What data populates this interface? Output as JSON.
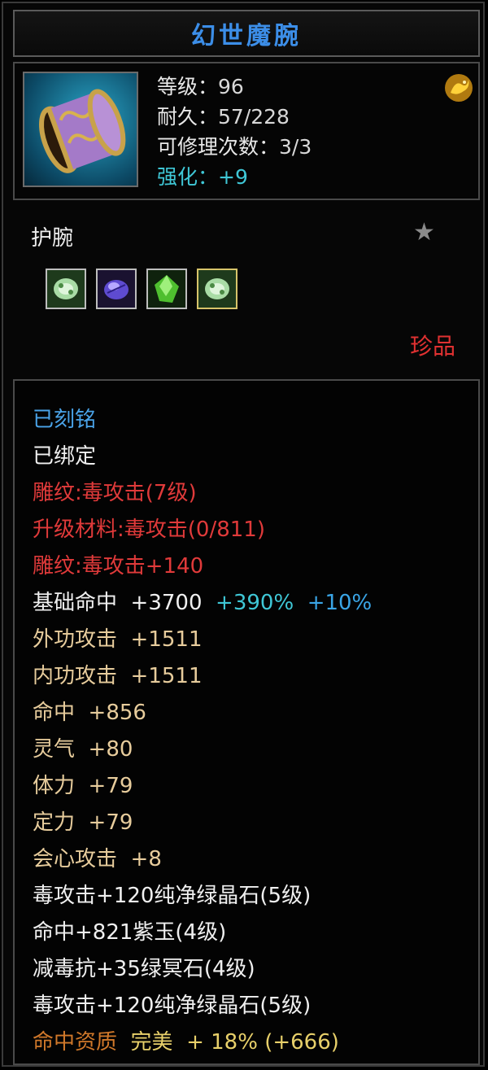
{
  "title": "幻世魔腕",
  "item": {
    "icon": "bracer-item-icon",
    "stats": [
      {
        "label": "等级：",
        "value": "96"
      },
      {
        "label": "耐久：",
        "value": "57/228"
      },
      {
        "label": "可修理次数：",
        "value": "3/3"
      },
      {
        "label": "强化：",
        "value": "+9"
      }
    ],
    "badge_icon": "gold-dragon-icon"
  },
  "type_label": "护腕",
  "star_icon": "star-icon",
  "gem_slots": [
    "green-gem-icon",
    "purple-gem-icon",
    "green-crystal-icon",
    "green-gem-icon"
  ],
  "rarity": "珍品",
  "lines": {
    "engraved": "已刻铭",
    "bound": "已绑定",
    "carving": "雕纹:毒攻击(7级)",
    "upgrade_material": "升级材料:毒攻击(0/811)",
    "carving_bonus": "雕纹:毒攻击+140",
    "base_hit_label": "基础命中",
    "base_hit_value": "+3700",
    "base_hit_pct1": "+390%",
    "base_hit_pct2": "+10%",
    "attrs": [
      {
        "label": "外功攻击",
        "value": "+1511"
      },
      {
        "label": "内功攻击",
        "value": "+1511"
      },
      {
        "label": "命中",
        "value": "+856"
      },
      {
        "label": "灵气",
        "value": "+80"
      },
      {
        "label": "体力",
        "value": "+79"
      },
      {
        "label": "定力",
        "value": "+79"
      },
      {
        "label": "会心攻击",
        "value": "+8"
      }
    ],
    "gems": [
      "毒攻击+120纯净绿晶石(5级)",
      "命中+821紫玉(4级)",
      "减毒抗+35绿冥石(4级)",
      "毒攻击+120纯净绿晶石(5级)"
    ],
    "quality_label": "命中资质",
    "quality_grade": "完美",
    "quality_value": "+ 18% (+666)"
  }
}
